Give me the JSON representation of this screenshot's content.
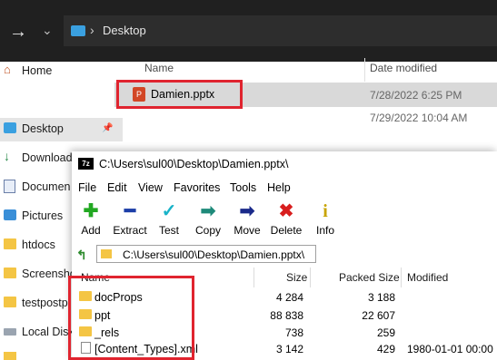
{
  "address_bar": {
    "path": "Desktop"
  },
  "nav": [
    {
      "label": "Home",
      "icon": "home-icon"
    },
    {
      "label": "Desktop",
      "icon": "desktop-icon",
      "selected": true
    },
    {
      "label": "Download",
      "icon": "download-icon"
    },
    {
      "label": "Documen",
      "icon": "documents-icon"
    },
    {
      "label": "Pictures",
      "icon": "pictures-icon"
    },
    {
      "label": "htdocs",
      "icon": "folder-icon"
    },
    {
      "label": "Screensho",
      "icon": "folder-icon"
    },
    {
      "label": "testpostp",
      "icon": "folder-icon"
    },
    {
      "label": "Local Disk",
      "icon": "disk-icon"
    }
  ],
  "file_list": {
    "headers": {
      "name": "Name",
      "date": "Date modified"
    },
    "rows": [
      {
        "name": "Damien.pptx",
        "date": "7/28/2022 6:25 PM",
        "icon": "powerpoint-icon"
      },
      {
        "name": "",
        "date": "7/29/2022 10:04 AM"
      }
    ]
  },
  "zip": {
    "title": "C:\\Users\\sul00\\Desktop\\Damien.pptx\\",
    "logo": "7z",
    "menu": [
      "File",
      "Edit",
      "View",
      "Favorites",
      "Tools",
      "Help"
    ],
    "toolbar": [
      {
        "label": "Add",
        "icon": "add-icon"
      },
      {
        "label": "Extract",
        "icon": "extract-icon"
      },
      {
        "label": "Test",
        "icon": "test-icon"
      },
      {
        "label": "Copy",
        "icon": "copy-icon"
      },
      {
        "label": "Move",
        "icon": "move-icon"
      },
      {
        "label": "Delete",
        "icon": "delete-icon"
      },
      {
        "label": "Info",
        "icon": "info-icon"
      }
    ],
    "address": "C:\\Users\\sul00\\Desktop\\Damien.pptx\\",
    "columns": {
      "name": "Name",
      "size": "Size",
      "packed": "Packed Size",
      "modified": "Modified"
    },
    "rows": [
      {
        "name": "docProps",
        "size": "4 284",
        "packed": "3 188",
        "modified": "",
        "type": "folder"
      },
      {
        "name": "ppt",
        "size": "88 838",
        "packed": "22 607",
        "modified": "",
        "type": "folder"
      },
      {
        "name": "_rels",
        "size": "738",
        "packed": "259",
        "modified": "",
        "type": "folder"
      },
      {
        "name": "[Content_Types].xml",
        "size": "3 142",
        "packed": "429",
        "modified": "1980-01-01 00:00",
        "type": "file"
      }
    ]
  },
  "colors": {
    "highlight_box": "#e0242f",
    "folder": "#f4c544",
    "dark_bar": "#202020"
  }
}
